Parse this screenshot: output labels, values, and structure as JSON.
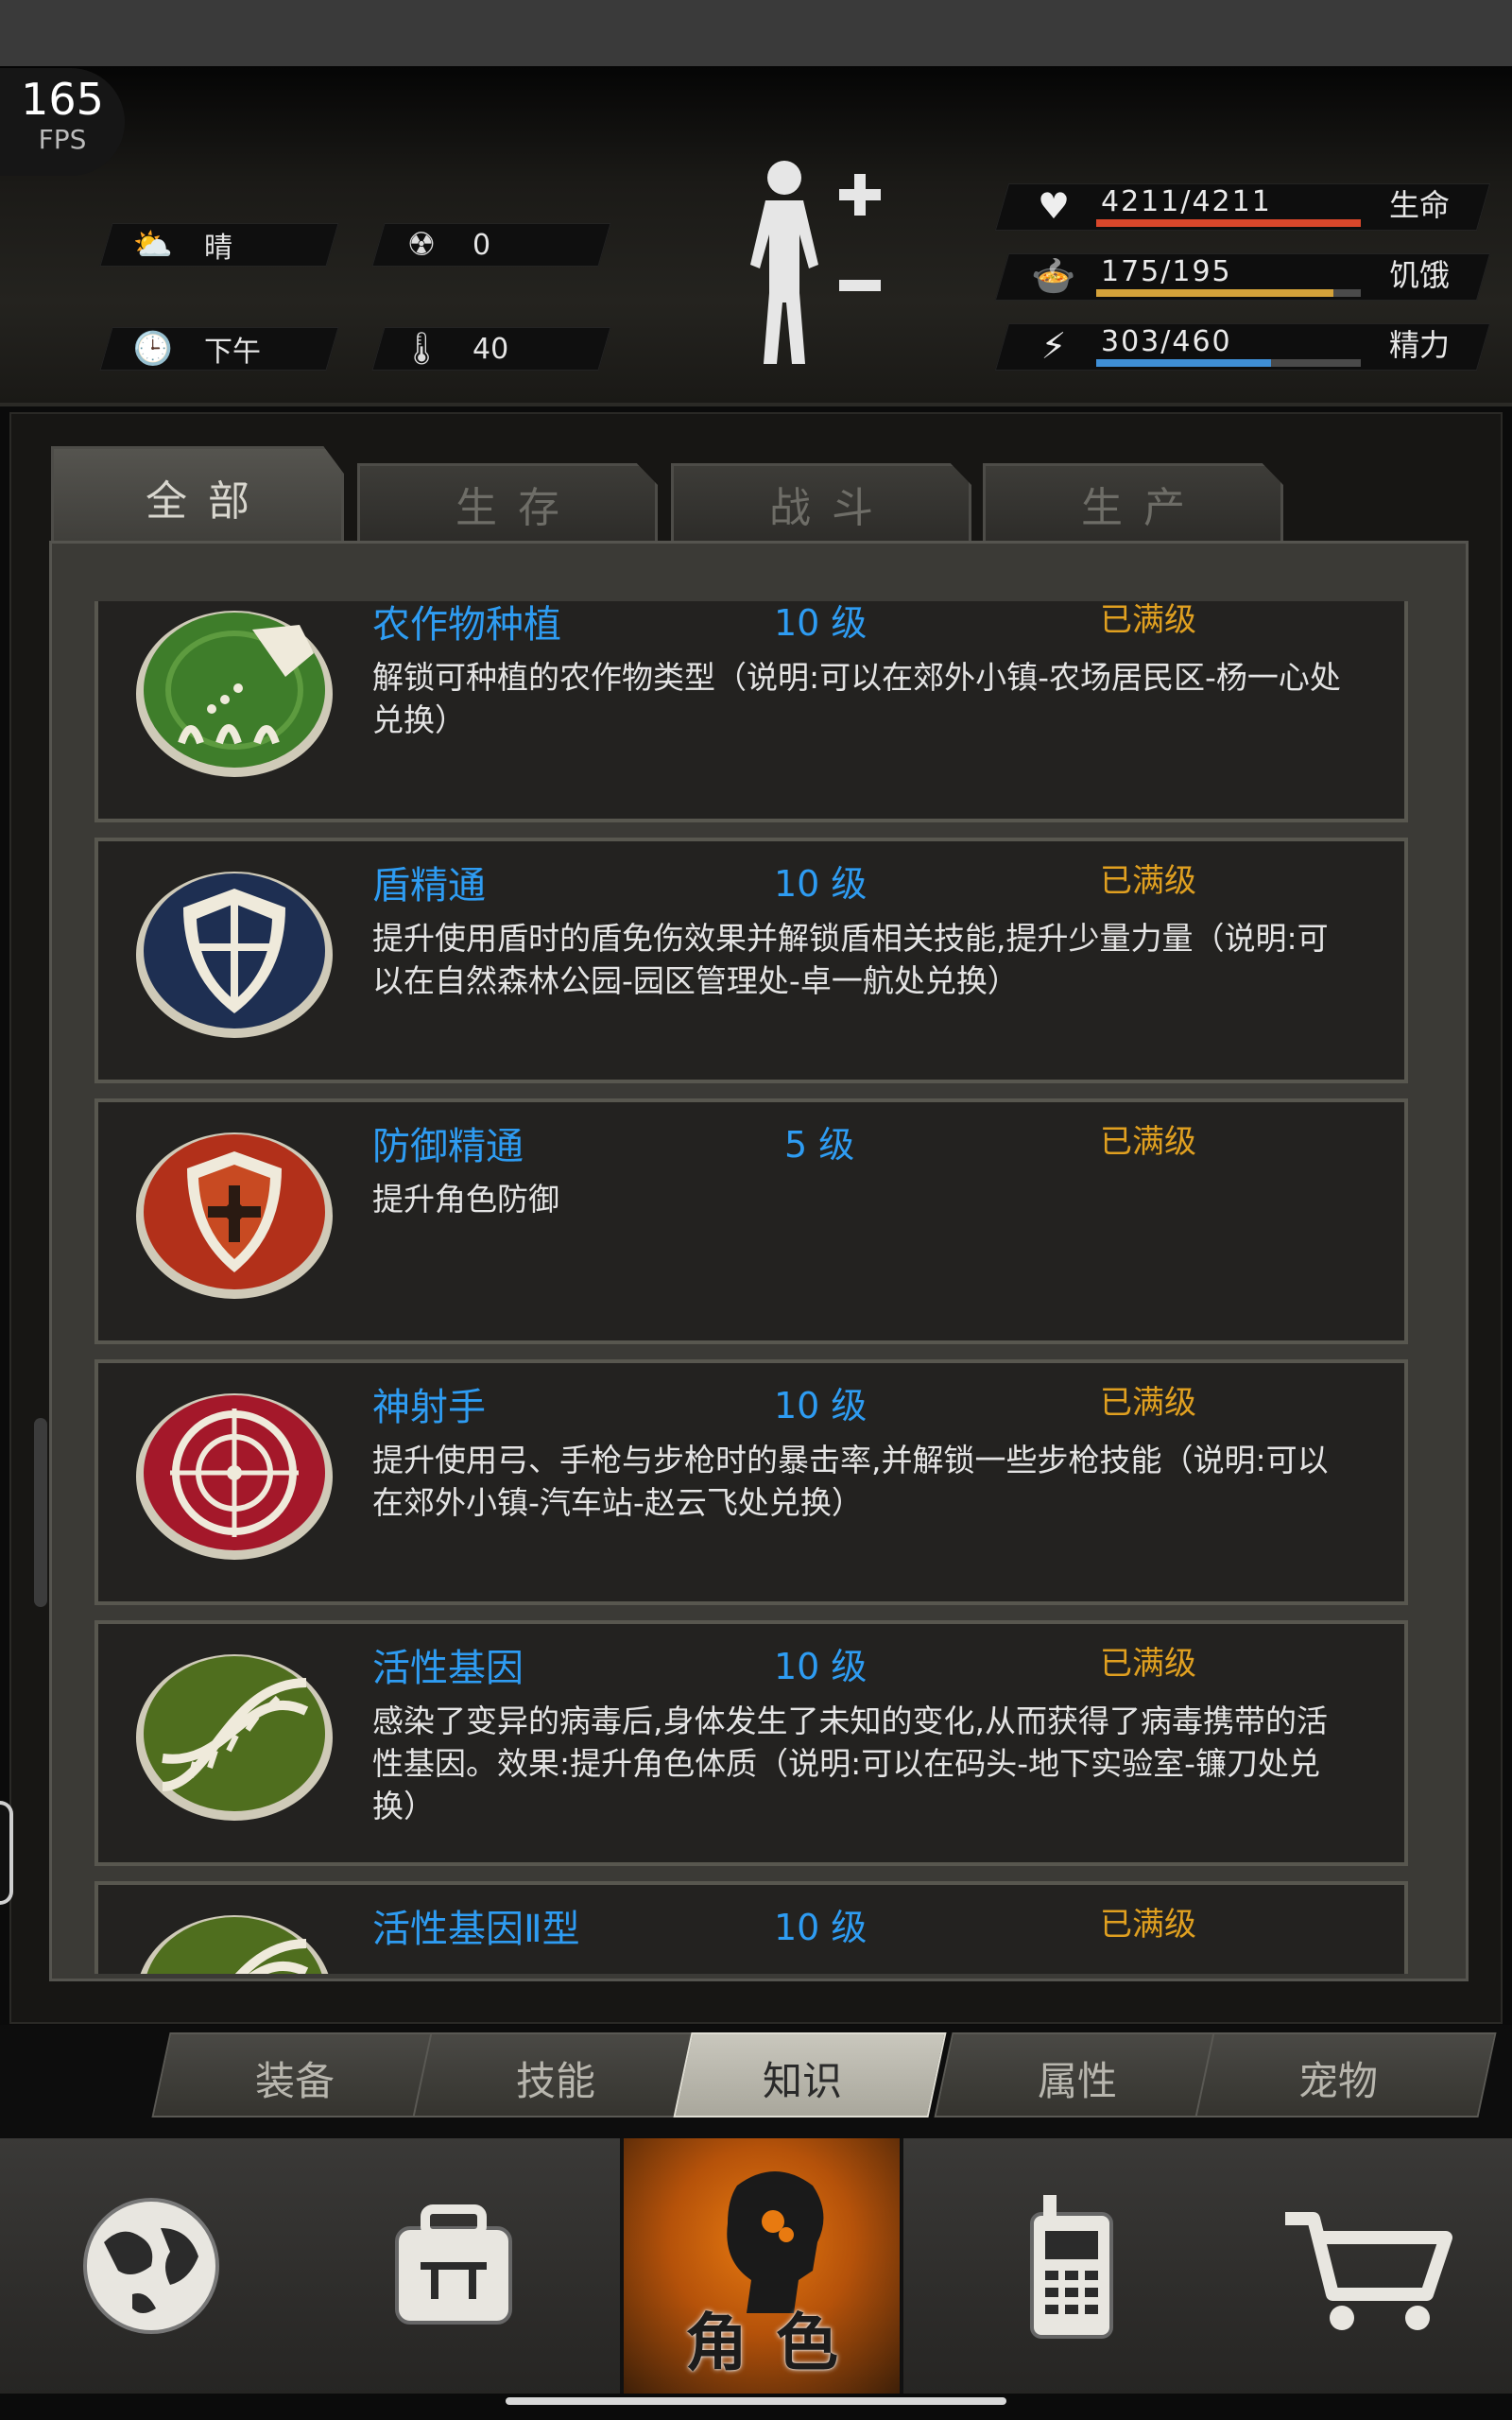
{
  "fps": {
    "value": "165",
    "label": "FPS"
  },
  "environment": {
    "weather": {
      "icon": "cloud-sun-icon",
      "label": "晴"
    },
    "radiation": {
      "icon": "radiation-icon",
      "value": "0"
    },
    "time": {
      "icon": "clock-icon",
      "label": "下午"
    },
    "temperature": {
      "icon": "thermometer-icon",
      "value": "40"
    }
  },
  "stats": {
    "health": {
      "value": "4211/4211",
      "label": "生命",
      "fraction": 1.0,
      "color": "#d9472b"
    },
    "hunger": {
      "value": "175/195",
      "label": "饥饿",
      "fraction": 0.897,
      "color": "#d4a23a"
    },
    "energy": {
      "value": "303/460",
      "label": "精力",
      "fraction": 0.659,
      "color": "#3f8fd6"
    }
  },
  "tabs": [
    {
      "label": "全部",
      "active": true
    },
    {
      "label": "生存",
      "active": false
    },
    {
      "label": "战斗",
      "active": false
    },
    {
      "label": "生产",
      "active": false
    }
  ],
  "skills": [
    {
      "name": "农作物种植",
      "level": "10 级",
      "status": "已满级",
      "icon": "watering-plants-icon",
      "description": "解锁可种植的农作物类型（说明:可以在郊外小镇-农场居民区-杨一心处兑换）"
    },
    {
      "name": "盾精通",
      "level": "10 级",
      "status": "已满级",
      "icon": "shield-icon",
      "description": "提升使用盾时的盾免伤效果并解锁盾相关技能,提升少量力量（说明:可以在自然森林公园-园区管理处-卓一航处兑换）"
    },
    {
      "name": "防御精通",
      "level": "5 级",
      "status": "已满级",
      "icon": "defense-emblem-icon",
      "description": "提升角色防御"
    },
    {
      "name": "神射手",
      "level": "10 级",
      "status": "已满级",
      "icon": "crosshair-target-icon",
      "description": "提升使用弓、手枪与步枪时的暴击率,并解锁一些步枪技能（说明:可以在郊外小镇-汽车站-赵云飞处兑换）"
    },
    {
      "name": "活性基因",
      "level": "10 级",
      "status": "已满级",
      "icon": "dna-icon",
      "description": "感染了变异的病毒后,身体发生了未知的变化,从而获得了病毒携带的活性基因。效果:提升角色体质（说明:可以在码头-地下实验室-镰刀处兑换）"
    },
    {
      "name": "活性基因Ⅱ型",
      "level": "10 级",
      "status": "已满级",
      "icon": "dna-icon",
      "description": ""
    }
  ],
  "subtabs": [
    {
      "label": "装备",
      "active": false
    },
    {
      "label": "技能",
      "active": false
    },
    {
      "label": "知识",
      "active": true
    },
    {
      "label": "属性",
      "active": false
    },
    {
      "label": "宠物",
      "active": false
    }
  ],
  "bottom_nav": [
    {
      "icon": "globe-icon",
      "label": ""
    },
    {
      "icon": "backpack-icon",
      "label": ""
    },
    {
      "icon": "character-head-icon",
      "label": "角色",
      "active": true
    },
    {
      "icon": "walkie-talkie-icon",
      "label": ""
    },
    {
      "icon": "shopping-cart-icon",
      "label": ""
    }
  ]
}
